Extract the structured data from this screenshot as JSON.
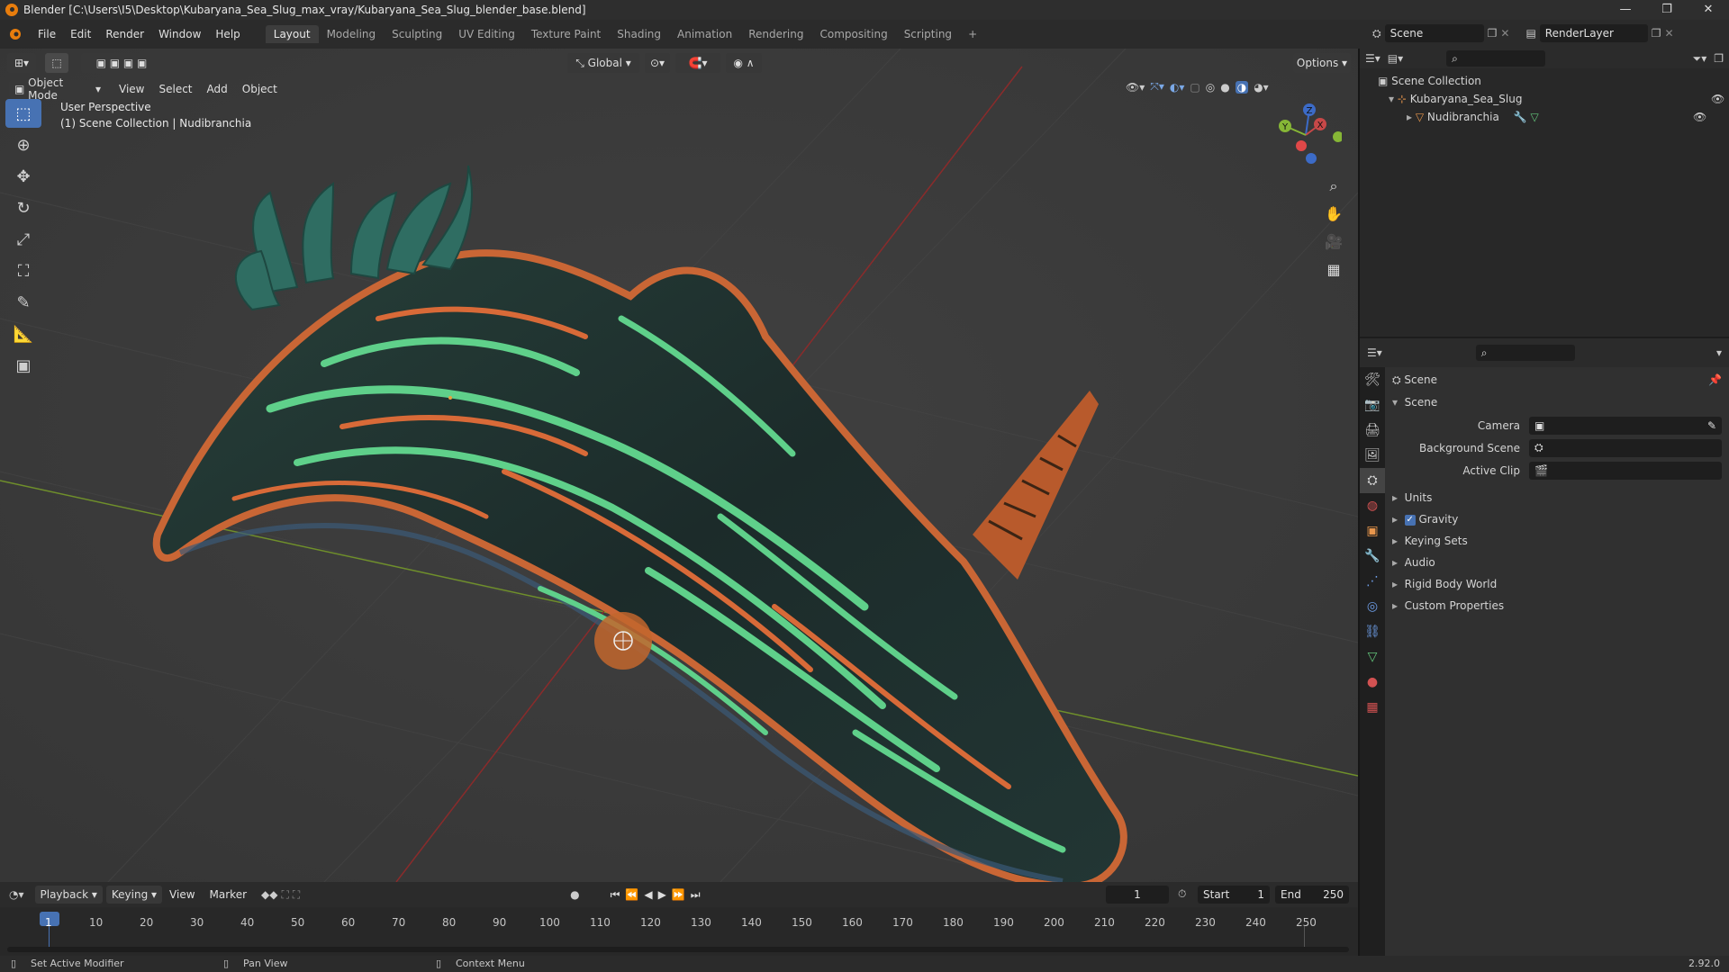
{
  "window": {
    "title": "Blender [C:\\Users\\I5\\Desktop\\Kubaryana_Sea_Slug_max_vray/Kubaryana_Sea_Slug_blender_base.blend]",
    "controls": [
      "—",
      "❐",
      "✕"
    ]
  },
  "menu": {
    "items": [
      "File",
      "Edit",
      "Render",
      "Window",
      "Help"
    ],
    "workspaces": [
      "Layout",
      "Modeling",
      "Sculpting",
      "UV Editing",
      "Texture Paint",
      "Shading",
      "Animation",
      "Rendering",
      "Compositing",
      "Scripting",
      "+"
    ],
    "active_workspace": "Layout",
    "scene_name": "Scene",
    "view_layer": "RenderLayer"
  },
  "viewport": {
    "mode": "Object Mode",
    "menus": [
      "View",
      "Select",
      "Add",
      "Object"
    ],
    "orientation": "Global",
    "options_label": "Options",
    "info_line1": "User Perspective",
    "info_line2": "(1) Scene Collection | Nudibranchia",
    "gizmo": {
      "z": "Z",
      "y": "Y",
      "x": "X"
    }
  },
  "outliner": {
    "root": "Scene Collection",
    "items": [
      {
        "name": "Kubaryana_Sea_Slug",
        "type": "empty"
      },
      {
        "name": "Nudibranchia",
        "type": "mesh"
      }
    ]
  },
  "properties": {
    "context": "Scene",
    "panel_title": "Scene",
    "fields": [
      {
        "label": "Camera",
        "value": ""
      },
      {
        "label": "Background Scene",
        "value": ""
      },
      {
        "label": "Active Clip",
        "value": ""
      }
    ],
    "sections": [
      "Units",
      "Gravity",
      "Keying Sets",
      "Audio",
      "Rigid Body World",
      "Custom Properties"
    ],
    "gravity_checked": true
  },
  "timeline": {
    "menus": [
      "Playback",
      "Keying",
      "View",
      "Marker"
    ],
    "current_frame": "1",
    "start_label": "Start",
    "start": "1",
    "end_label": "End",
    "end": "250",
    "ruler": [
      "1",
      "10",
      "20",
      "30",
      "40",
      "50",
      "60",
      "70",
      "80",
      "90",
      "100",
      "110",
      "120",
      "130",
      "140",
      "150",
      "160",
      "170",
      "180",
      "190",
      "200",
      "210",
      "220",
      "230",
      "240",
      "250"
    ]
  },
  "status": {
    "left": "Set Active Modifier",
    "middle": "Pan View",
    "right": "Context Menu",
    "version": "2.92.0"
  },
  "colors": {
    "accent": "#4772b3",
    "slug_dark": "#1f2e2c",
    "slug_green": "#5fd08a",
    "slug_orange": "#d86a38",
    "x_axis": "#8a2b2b",
    "y_axis": "#6f8f2b"
  }
}
